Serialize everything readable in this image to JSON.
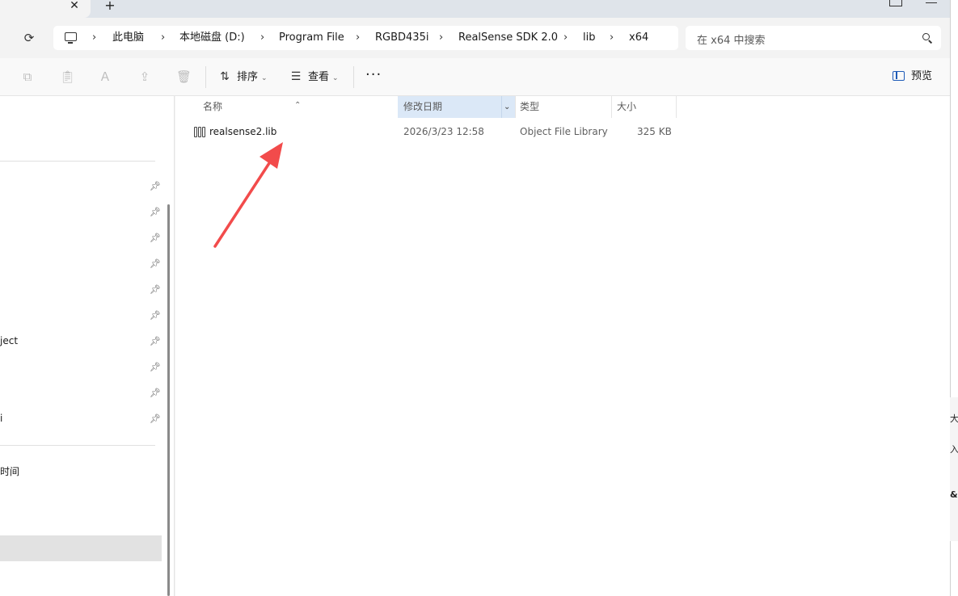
{
  "tab": {
    "close_glyph": "✕",
    "new_glyph": "+"
  },
  "address": {
    "refresh_icon": "refresh-icon",
    "breadcrumbs": [
      "此电脑",
      "本地磁盘 (D:)",
      "Program File",
      "RGBD435i",
      "RealSense SDK 2.0",
      "lib",
      "x64"
    ],
    "separator": "›",
    "search_placeholder": "在 x64 中搜索"
  },
  "toolbar": {
    "sort_label": "排序",
    "view_label": "查看",
    "more_label": "···",
    "preview_label": "预览"
  },
  "nav": {
    "partial_items": [
      "ject",
      "i",
      "时间"
    ]
  },
  "columns": {
    "name": "名称",
    "modified": "修改日期",
    "type": "类型",
    "size": "大小"
  },
  "files": [
    {
      "name": "realsense2.lib",
      "modified": "2026/3/23 12:58",
      "type": "Object File Library",
      "size": "325 KB"
    }
  ],
  "background_window": {
    "partial_text": [
      "大",
      "入",
      "&"
    ]
  },
  "colors": {
    "accent": "#1e5bb8",
    "annotation_arrow": "#f24b4b",
    "column_selected_bg": "#dbe8f7"
  }
}
